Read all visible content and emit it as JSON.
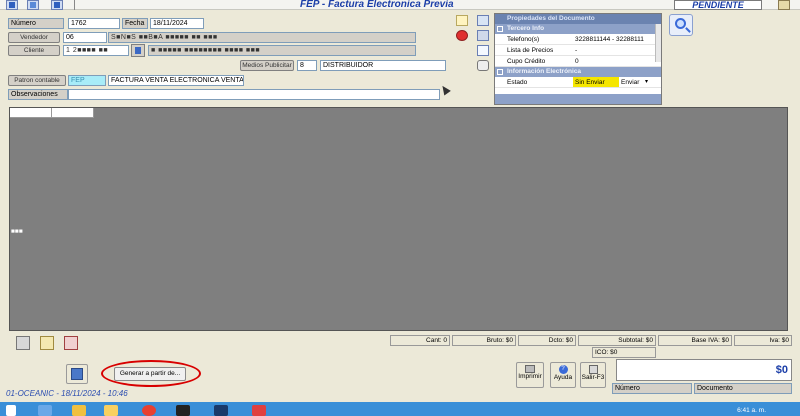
{
  "window": {
    "title": "FEP - Factura Electronica Previa",
    "status": "PENDIENTE"
  },
  "form": {
    "numero_label": "Número",
    "numero_value": "1762",
    "fecha_label": "Fecha",
    "fecha_value": "18/11/2024",
    "vendedor_label": "Vendedor",
    "vendedor_code": "06",
    "vendedor_name": "S■N■S ■■B■A ■■■■■ ■■ ■■■",
    "cliente_label": "Cliente",
    "cliente_code": "1 2■■■■ ■■",
    "cliente_name": "■ ■■■■■ ■■■■■■■■ ■■■■ ■■■",
    "medios_label": "Medios Publicitar",
    "medios_code": "8",
    "medios_value": "DISTRIBUIDOR",
    "patron_label": "Patron contable",
    "patron_code": "FEP",
    "patron_value": "FACTURA VENTA ELECTRONICA VENTA",
    "observaciones_label": "Observaciones",
    "observaciones_value": ""
  },
  "properties": {
    "header": "Propiedades del Documento",
    "section_tercero": "Tercero Info",
    "rows_tercero": [
      {
        "k": "Telefono(s)",
        "v": "3228811144 - 32288111"
      },
      {
        "k": "Lista de Precios",
        "v": "-"
      },
      {
        "k": "Cupo Crédito",
        "v": "0"
      }
    ],
    "section_info": "Información Electrónica",
    "estado_label": "Estado",
    "estado_value": "Sin Enviar",
    "estado_action": "Enviar"
  },
  "grid": {
    "row_indicator": "■■■"
  },
  "totals": {
    "cant": "Cant: 0",
    "bruto": "Bruto: $0",
    "dcto": "Dcto: $0",
    "subtotal": "Subtotal: $0",
    "base_iva": "Base IVA: $0",
    "iva": "Iva: $0",
    "ico": "ICO: $0",
    "total": "$0"
  },
  "buttons": {
    "generar": "Generar a partir de...",
    "imprimir": "Imprimir",
    "ayuda": "Ayuda",
    "salir": "Salir-F3"
  },
  "footer": {
    "status_line": "01-OCEANIC - 18/11/2024 - 10:46",
    "numero_label": "Número",
    "documento_label": "Documento"
  },
  "taskbar": {
    "clock": "6:41 a. m."
  },
  "colors": {
    "accent": "#1b3ea8",
    "panel_header": "#6b83b0",
    "grid_bg": "#7f7f7f",
    "highlight_red": "#d80000",
    "estado_yellow": "#f5e600"
  }
}
